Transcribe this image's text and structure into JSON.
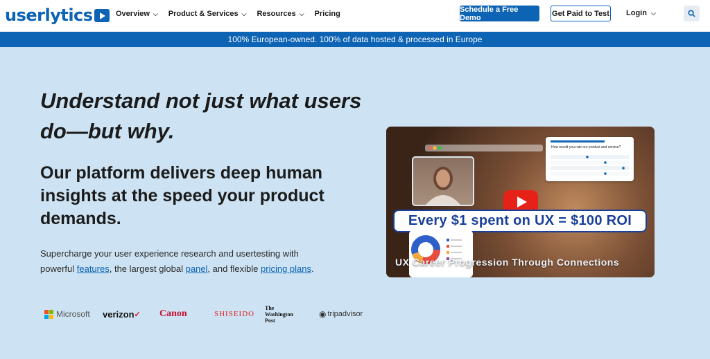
{
  "brand": {
    "name": "userlytics",
    "color": "#0d63b4"
  },
  "nav": {
    "items": [
      {
        "label": "Overview",
        "has_dropdown": true
      },
      {
        "label": "Product & Services",
        "has_dropdown": true
      },
      {
        "label": "Resources",
        "has_dropdown": true
      },
      {
        "label": "Pricing",
        "has_dropdown": false
      }
    ],
    "demo_button": "Schedule a Free Demo",
    "paid_button": "Get Paid to Test",
    "login": "Login",
    "search_icon": "search-icon"
  },
  "banner": {
    "text": "100% European-owned. 100% of data hosted & processed in Europe"
  },
  "hero": {
    "headline": "Understand not just what users do—but why.",
    "subheadline": "Our platform delivers deep human insights at the speed your product demands.",
    "para_before": "Supercharge your user experience research and usertesting with powerful ",
    "link_features": "features",
    "para_mid1": ", the largest global ",
    "link_panel": "panel",
    "para_mid2": ", and flexible ",
    "link_pricing": "pricing plans",
    "para_end": "."
  },
  "logos": [
    "Microsoft",
    "verizon",
    "Canon",
    "SHISEIDO",
    "The Washington Post",
    "tripadvisor"
  ],
  "video": {
    "roi_text": "Every $1 spent on UX = $100 ROI",
    "caption": "UX Career Progression Through Connections",
    "survey_question": "How would you rate our product and service?",
    "play_icon": "play-icon"
  }
}
